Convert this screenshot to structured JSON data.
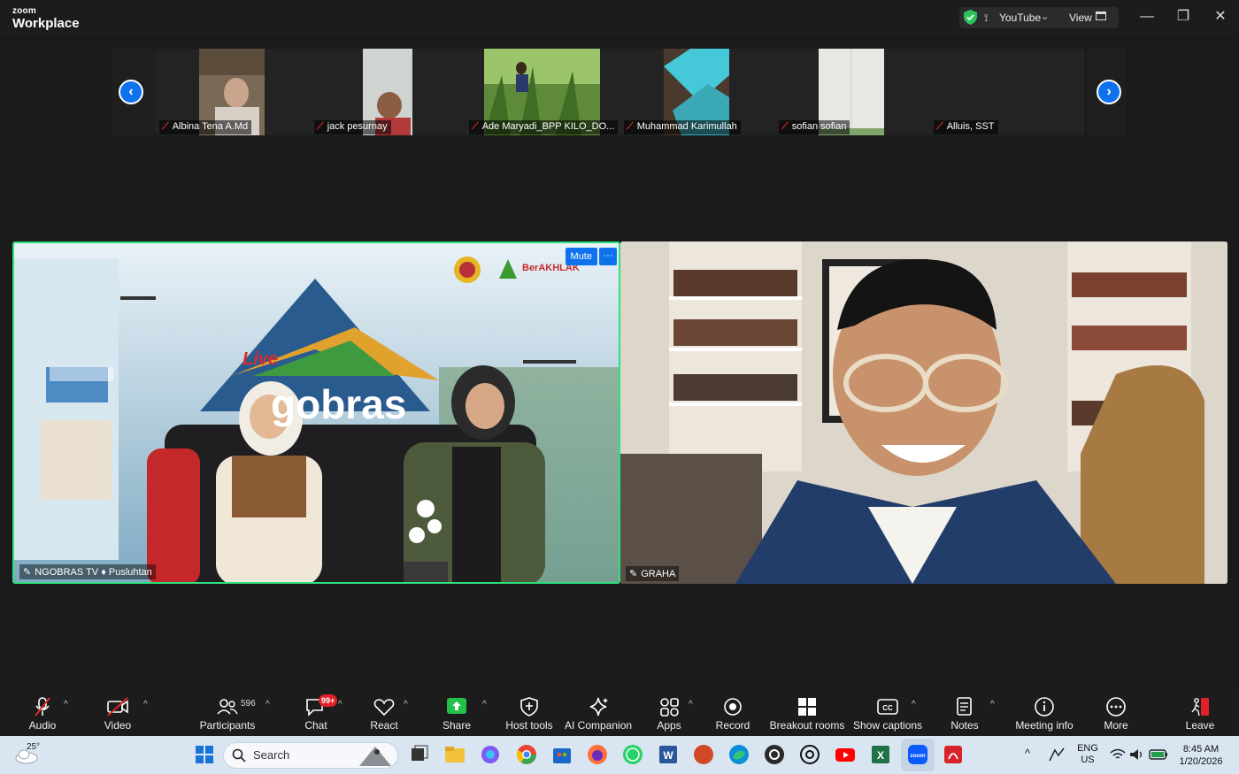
{
  "app": {
    "logo_line1": "zoom",
    "logo_line2": "Workplace",
    "stream_label": "YouTube",
    "view_label": "View"
  },
  "filmstrip": {
    "participants": [
      {
        "name": "Albina Tena A.Md"
      },
      {
        "name": "jack pesurnay"
      },
      {
        "name": "Ade Maryadi_BPP KILO_DO..."
      },
      {
        "name": "Muhammad Karimullah"
      },
      {
        "name": "sofian sofian"
      },
      {
        "name": "Alluis, SST"
      }
    ]
  },
  "main_videos": {
    "left": {
      "name": "NGOBRAS TV ♦ Pusluhtan",
      "mute_label": "Mute",
      "more_label": "···",
      "banner_live": "Live",
      "banner_title": "gobras",
      "sponsor": "BerAKHLAK"
    },
    "right": {
      "name": "GRAHA"
    }
  },
  "toolbar": {
    "audio": "Audio",
    "video": "Video",
    "participants": "Participants",
    "participants_count": "596",
    "chat": "Chat",
    "chat_badge": "99+",
    "react": "React",
    "share": "Share",
    "host_tools": "Host tools",
    "ai_companion": "AI Companion",
    "apps": "Apps",
    "record": "Record",
    "breakout_rooms": "Breakout rooms",
    "show_captions": "Show captions",
    "notes": "Notes",
    "meeting_info": "Meeting info",
    "more": "More",
    "leave": "Leave"
  },
  "taskbar": {
    "weather_temp": "25°",
    "search_placeholder": "Search",
    "lang_line1": "ENG",
    "lang_line2": "US",
    "time": "8:45 AM",
    "date": "1/20/2026"
  },
  "colors": {
    "accent_blue": "#0e72ed",
    "active_speaker": "#2ee07c",
    "muted_red": "#e02828",
    "share_green": "#23c14a"
  }
}
